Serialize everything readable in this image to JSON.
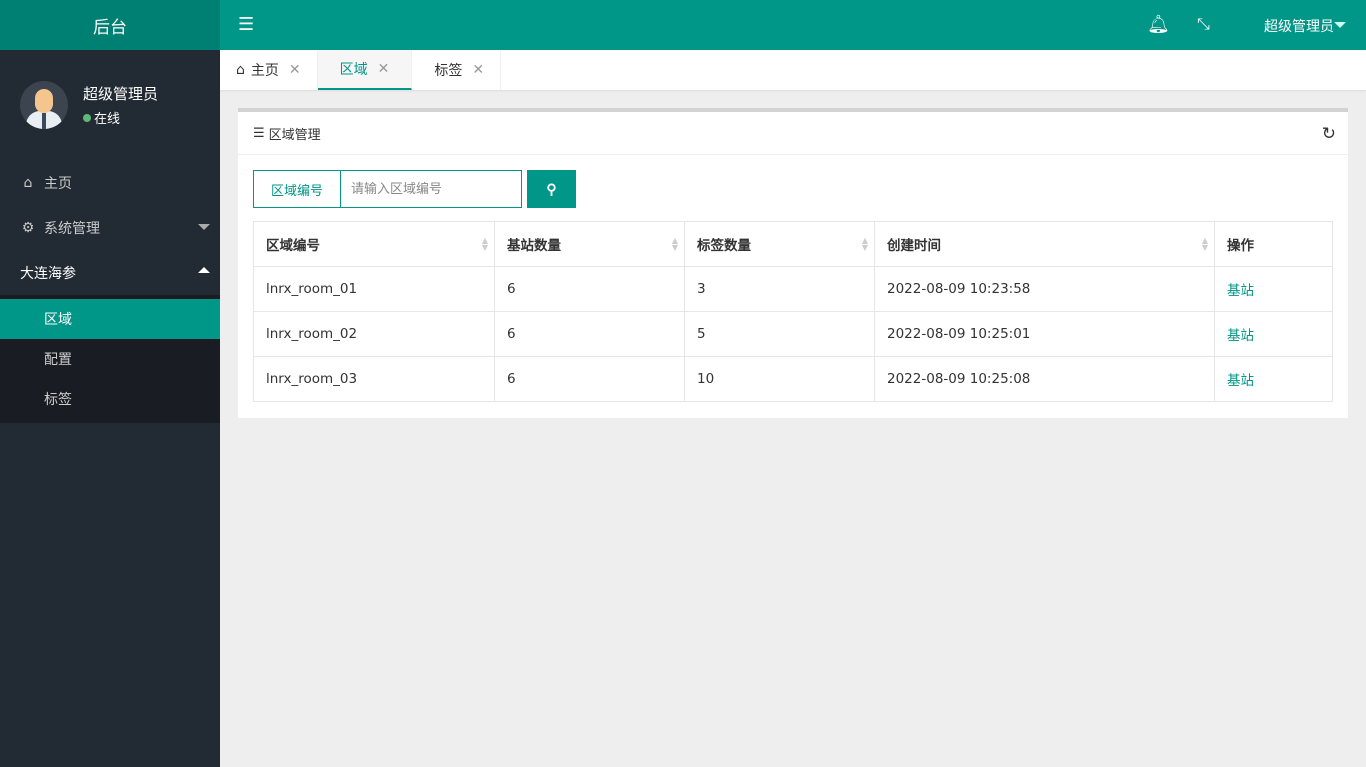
{
  "app": {
    "title": "后台"
  },
  "user": {
    "name": "超级管理员",
    "status": "在线"
  },
  "sidebar": {
    "items": [
      {
        "label": "主页",
        "icon": "home-icon"
      },
      {
        "label": "系统管理",
        "icon": "gear-icon"
      },
      {
        "label": "大连海参"
      }
    ],
    "sub_items": [
      {
        "label": "区域",
        "active": true
      },
      {
        "label": "配置"
      },
      {
        "label": "标签"
      }
    ]
  },
  "topbar": {
    "user": "超级管理员"
  },
  "tabs": [
    {
      "label": "主页"
    },
    {
      "label": "区域",
      "active": true
    },
    {
      "label": "标签"
    }
  ],
  "panel": {
    "title": "区域管理"
  },
  "search": {
    "label": "区域编号",
    "placeholder": "请输入区域编号",
    "value": ""
  },
  "table": {
    "headers": [
      "区域编号",
      "基站数量",
      "标签数量",
      "创建时间",
      "操作"
    ],
    "rows": [
      [
        "lnrx_room_01",
        "6",
        "3",
        "2022-08-09 10:23:58",
        "基站"
      ],
      [
        "lnrx_room_02",
        "6",
        "5",
        "2022-08-09 10:25:01",
        "基站"
      ],
      [
        "lnrx_room_03",
        "6",
        "10",
        "2022-08-09 10:25:08",
        "基站"
      ]
    ]
  },
  "colors": {
    "primary": "#009688",
    "sidebar": "#222a33"
  }
}
